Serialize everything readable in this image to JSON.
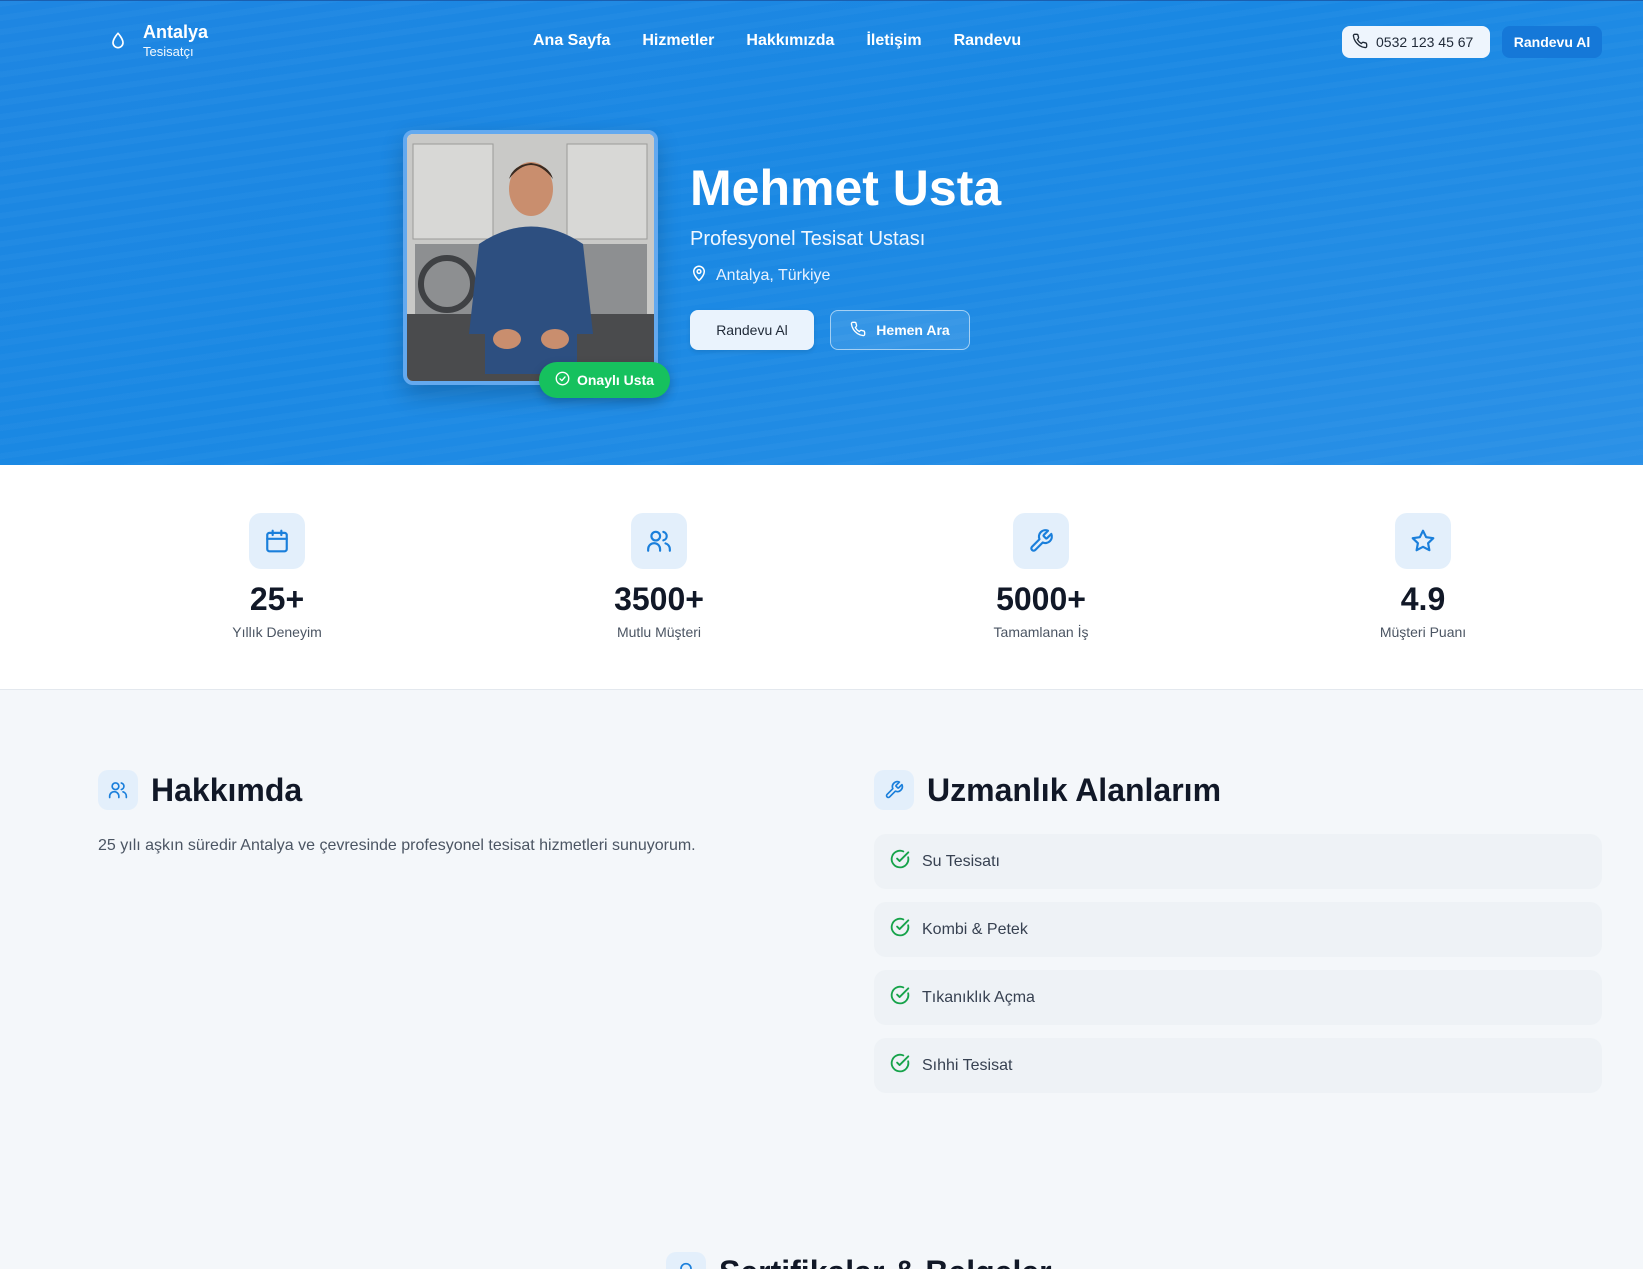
{
  "brand": {
    "title": "Antalya",
    "subtitle": "Tesisatçı"
  },
  "nav": {
    "items": [
      "Ana Sayfa",
      "Hizmetler",
      "Hakkımızda",
      "İletişim",
      "Randevu"
    ],
    "phone": "0532 123 45 67",
    "cta": "Randevu Al"
  },
  "profile": {
    "name": "Mehmet Usta",
    "title": "Profesyonel Tesisat Ustası",
    "location": "Antalya, Türkiye",
    "badge": "Onaylı Usta",
    "primary_button": "Randevu Al",
    "call_button": "Hemen Ara"
  },
  "stats": [
    {
      "icon": "calendar-icon",
      "value": "25+",
      "label": "Yıllık Deneyim"
    },
    {
      "icon": "users-icon",
      "value": "3500+",
      "label": "Mutlu Müşteri"
    },
    {
      "icon": "wrench-icon",
      "value": "5000+",
      "label": "Tamamlanan İş"
    },
    {
      "icon": "star-icon",
      "value": "4.9",
      "label": "Müşteri Puanı"
    }
  ],
  "about": {
    "title": "Hakkımda",
    "text": "25 yılı aşkın süredir Antalya ve çevresinde profesyonel tesisat hizmetleri sunuyorum."
  },
  "expertise": {
    "title": "Uzmanlık Alanlarım",
    "items": [
      "Su Tesisatı",
      "Kombi & Petek",
      "Tıkanıklık Açma",
      "Sıhhi Tesisat"
    ]
  },
  "certificates": {
    "title": "Sertifikalar & Belgeler"
  },
  "colors": {
    "primary": "#1a88e3",
    "accent_green": "#16c15e",
    "icon_bg": "#e3effb"
  }
}
